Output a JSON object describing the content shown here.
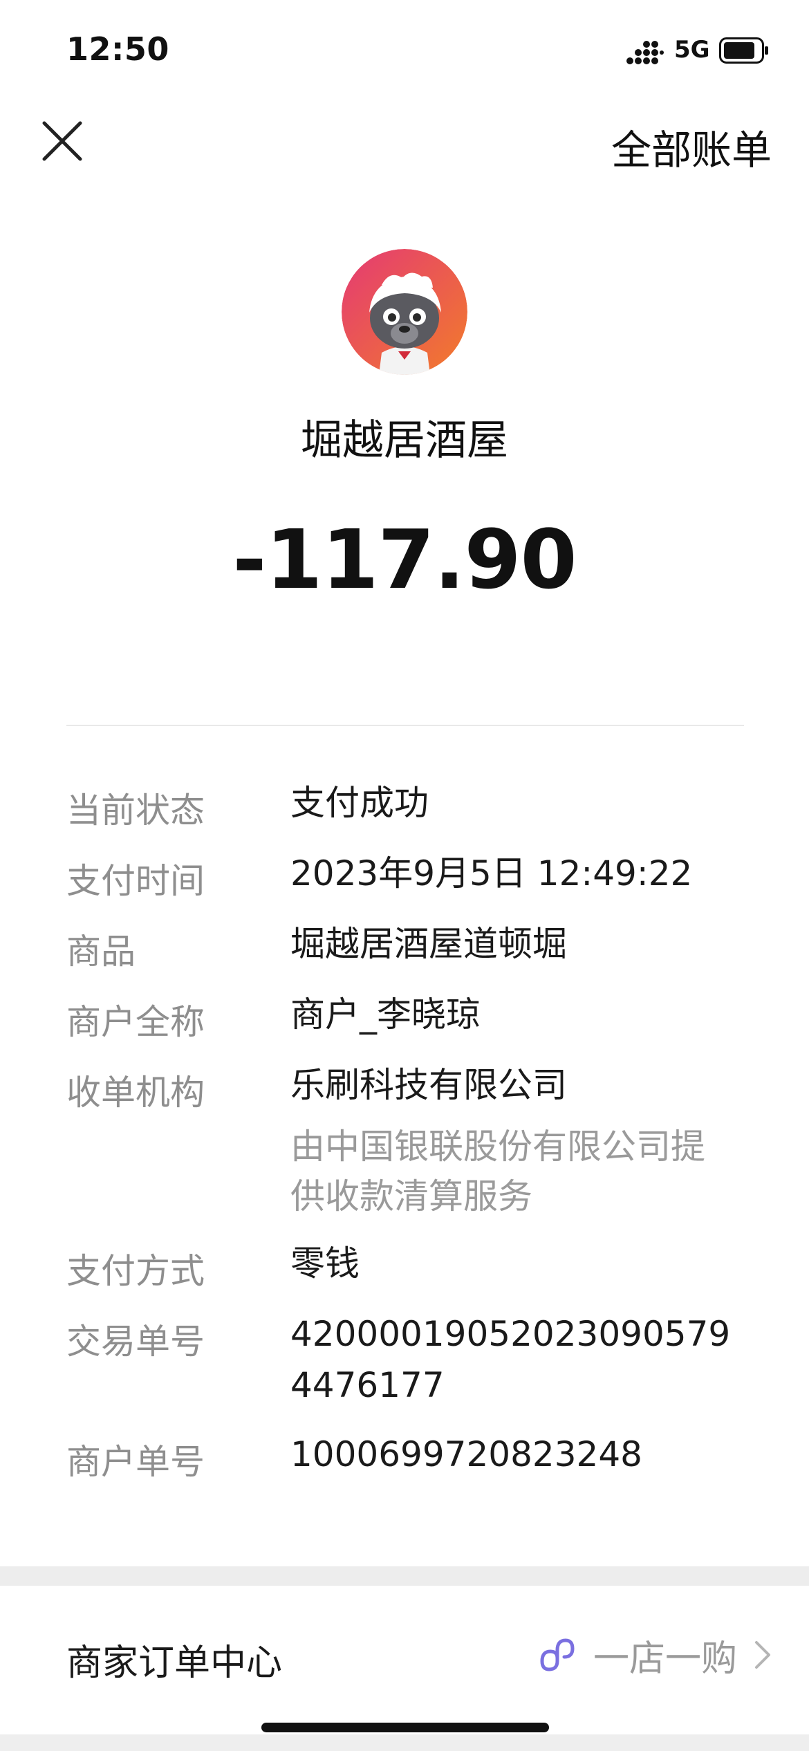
{
  "status_bar": {
    "time": "12:50",
    "network": "5G"
  },
  "nav": {
    "all_bills": "全部账单"
  },
  "merchant": {
    "name": "堀越居酒屋",
    "amount": "-117.90"
  },
  "details": {
    "status": {
      "label": "当前状态",
      "value": "支付成功"
    },
    "pay_time": {
      "label": "支付时间",
      "value": "2023年9月5日 12:49:22"
    },
    "product": {
      "label": "商品",
      "value": "堀越居酒屋道顿堀"
    },
    "merchant_full_name": {
      "label": "商户全称",
      "value": "商户_李晓琼"
    },
    "acquirer": {
      "label": "收单机构",
      "value": "乐刷科技有限公司",
      "sub_line1": "由中国银联股份有限公司提",
      "sub_line2": "供收款清算服务"
    },
    "pay_method": {
      "label": "支付方式",
      "value": "零钱"
    },
    "transaction_no": {
      "label": "交易单号",
      "line1": "42000019052023090579​4",
      "line2": "4476177"
    },
    "merchant_order_no": {
      "label": "商户单号",
      "value": "1000699720823248"
    }
  },
  "footer": {
    "order_center": "商家订单中心",
    "shop_label": "一店一购"
  },
  "icons": {
    "close": "close-icon",
    "avatar": "honey-badger-avatar",
    "mini_program": "mini-program-icon",
    "chevron": "chevron-right-icon"
  },
  "colors": {
    "label_gray": "#8e8e8e",
    "mini_program_purple": "#7a6fe0",
    "avatar_gradient_start": "#e64070",
    "avatar_gradient_end": "#f07a2c"
  }
}
